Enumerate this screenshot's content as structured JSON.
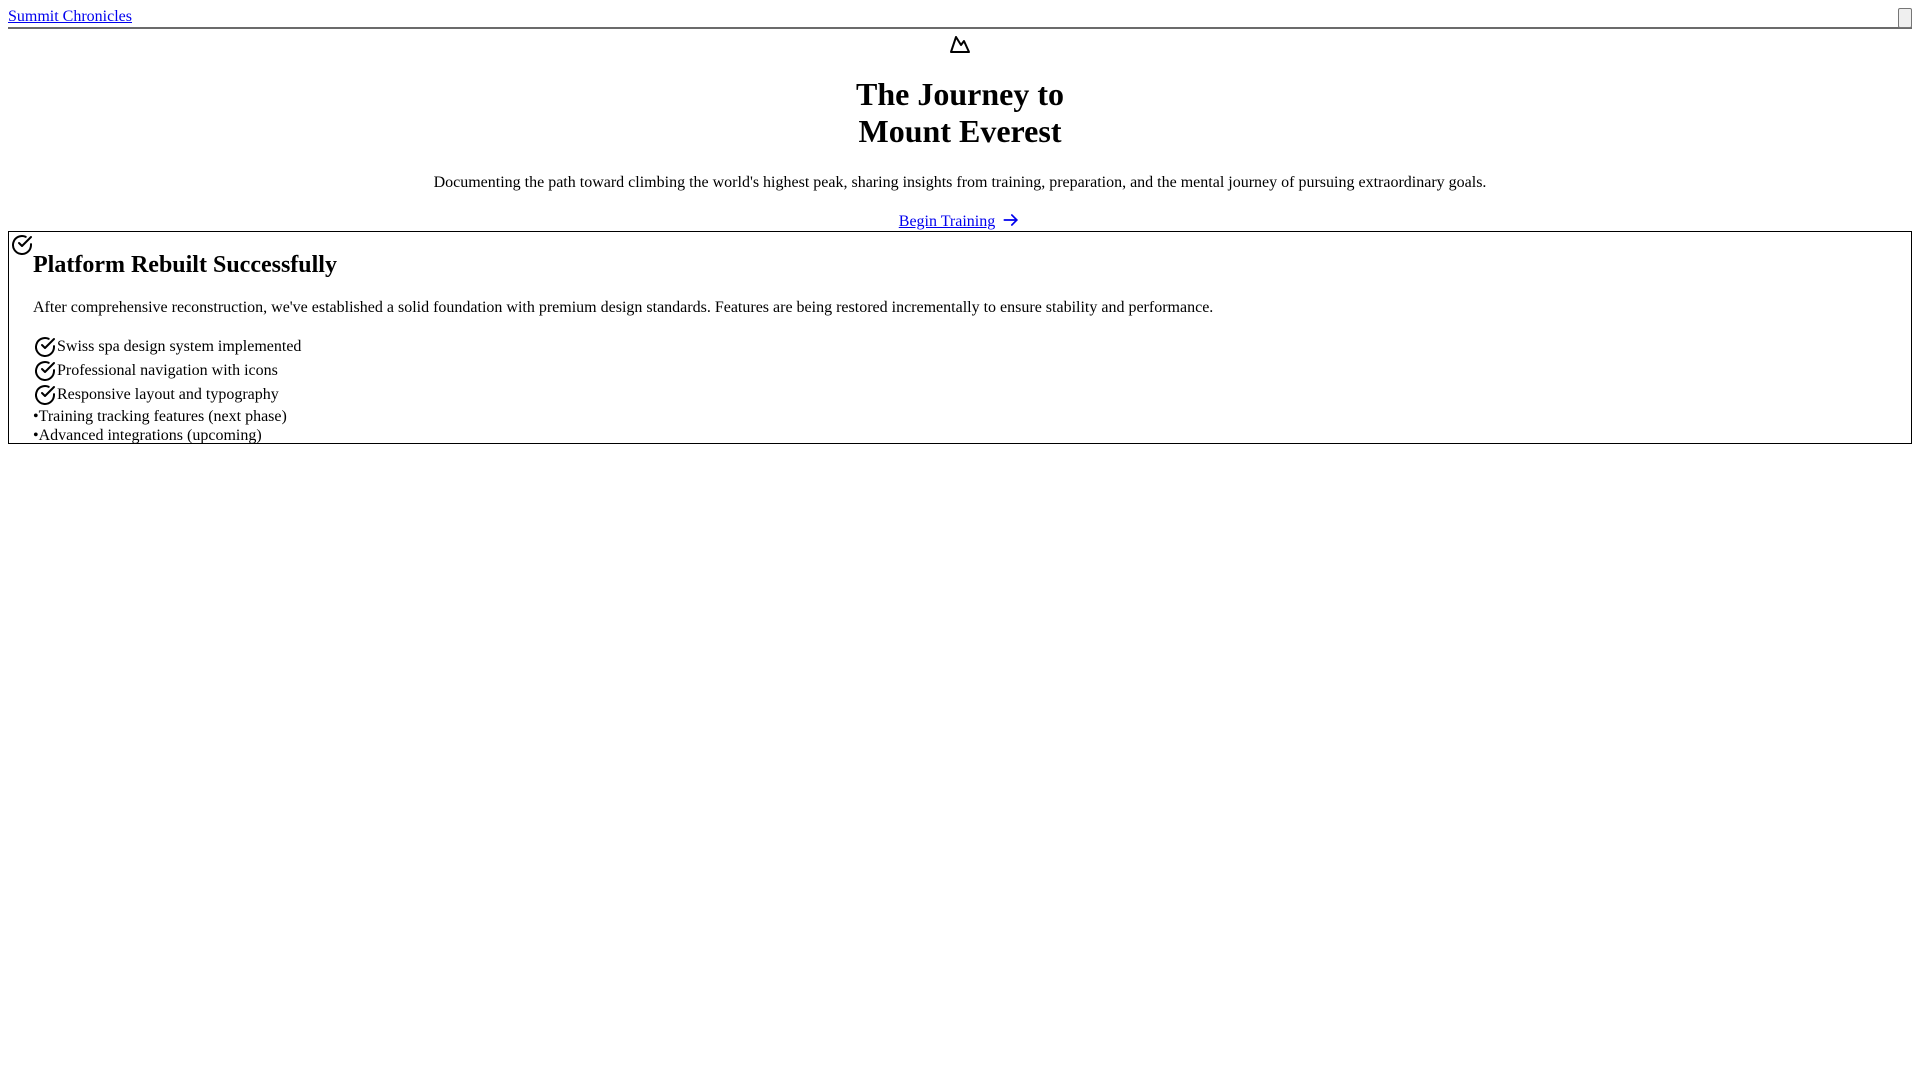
{
  "header": {
    "brand": "Summit Chronicles"
  },
  "hero": {
    "icon": "mountain-icon",
    "title_line1": "The Journey to",
    "title_line2": "Mount Everest",
    "description": "Documenting the path toward climbing the world's highest peak, sharing insights from training, preparation, and the mental journey of pursuing extraordinary goals.",
    "cta_label": "Begin Training",
    "cta_icon": "arrow-right-icon"
  },
  "status_card": {
    "icon": "check-circle-icon",
    "title": "Platform Rebuilt Successfully",
    "description": "After comprehensive reconstruction, we've established a solid foundation with premium design standards. Features are being restored incrementally to ensure stability and performance.",
    "completed": [
      "Swiss spa design system implemented",
      "Professional navigation with icons",
      "Responsive layout and typography"
    ],
    "pending_bullet": "•",
    "pending": [
      "Training tracking features (next phase)",
      "Advanced integrations (upcoming)"
    ]
  },
  "colors": {
    "link": "#0000ee",
    "text": "#000000",
    "divider": "#6b6b6b"
  }
}
